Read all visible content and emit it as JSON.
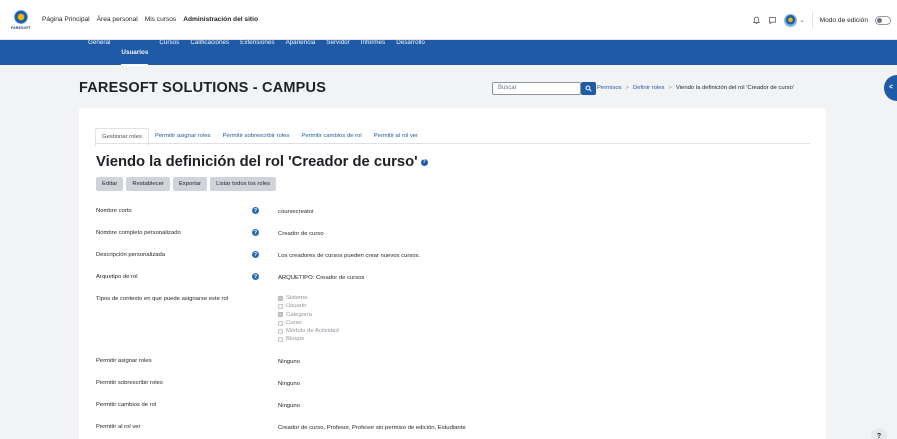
{
  "brand": {
    "logo_text": "FARESOFT"
  },
  "primary_nav": [
    {
      "label": "Página Principal",
      "active": false
    },
    {
      "label": "Área personal",
      "active": false
    },
    {
      "label": "Mis cursos",
      "active": false
    },
    {
      "label": "Administración del sitio",
      "active": true
    }
  ],
  "topbar_right": {
    "edit_mode_label": "Modo de edición",
    "edit_mode_on": false
  },
  "admin_nav": [
    {
      "label": "General",
      "active": false
    },
    {
      "label": "Usuarios",
      "active": true
    },
    {
      "label": "Cursos",
      "active": false
    },
    {
      "label": "Calificaciones",
      "active": false
    },
    {
      "label": "Extensiones",
      "active": false
    },
    {
      "label": "Apariencia",
      "active": false
    },
    {
      "label": "Servidor",
      "active": false
    },
    {
      "label": "Informes",
      "active": false
    },
    {
      "label": "Desarrollo",
      "active": false
    }
  ],
  "site_title": "FARESOFT SOLUTIONS - CAMPUS",
  "search": {
    "placeholder": "Buscar"
  },
  "breadcrumb": {
    "items": [
      "Permisos",
      "Definir roles"
    ],
    "current": "Viendo la definición del rol 'Creador de curso'"
  },
  "tabs": [
    {
      "label": "Gestionar roles",
      "active": true
    },
    {
      "label": "Permitir asignar roles",
      "active": false
    },
    {
      "label": "Permitir sobrescribir roles",
      "active": false
    },
    {
      "label": "Permitir cambios de rol",
      "active": false
    },
    {
      "label": "Permitir al rol ver",
      "active": false
    }
  ],
  "heading": "Viendo la definición del rol 'Creador de curso'",
  "actions": [
    "Editar",
    "Restablecer",
    "Exportar",
    "Listar todos los roles"
  ],
  "fields": [
    {
      "label": "Nombre corto",
      "help": true,
      "value": "coursecreator"
    },
    {
      "label": "Nombre completo personalizado",
      "help": true,
      "value": "Creador de curso"
    },
    {
      "label": "Descripción personalizada",
      "help": true,
      "value": "Los creadores de cursos pueden crear nuevos cursos."
    },
    {
      "label": "Arquetipo de rol",
      "help": true,
      "value": "ARQUETIPO: Creador de cursos"
    }
  ],
  "context": {
    "label": "Tipos de contexto en que puede asignarse este rol",
    "options": [
      {
        "label": "Sistema",
        "checked": true
      },
      {
        "label": "Usuario",
        "checked": false
      },
      {
        "label": "Categoría",
        "checked": true
      },
      {
        "label": "Curso",
        "checked": false
      },
      {
        "label": "Módulo de Actividad",
        "checked": false
      },
      {
        "label": "Bloque",
        "checked": false
      }
    ]
  },
  "permissions": [
    {
      "label": "Permitir asignar roles",
      "value": "Ninguno"
    },
    {
      "label": "Permitir sobrescribir roles",
      "value": "Ninguno"
    },
    {
      "label": "Permitir cambios de rol",
      "value": "Ninguno"
    },
    {
      "label": "Permitir al rol ver",
      "value": "Creador de curso, Profesor, Profesor sin permiso de edición, Estudiante"
    }
  ],
  "help_button": "?"
}
